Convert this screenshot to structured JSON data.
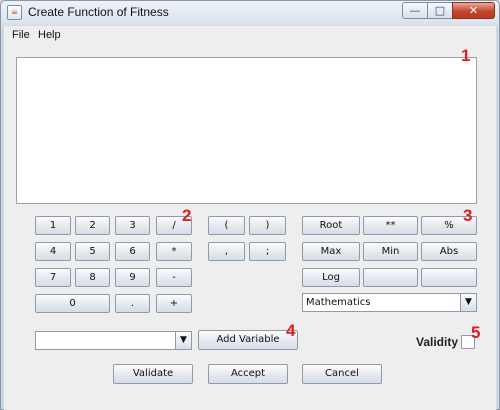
{
  "window": {
    "title": "Create Function of Fitness",
    "controls": {
      "minimize": "—",
      "maximize": "□",
      "close": "✕"
    }
  },
  "menu": [
    "File",
    "Help"
  ],
  "editor": {
    "value": ""
  },
  "keypad": {
    "row1": [
      "1",
      "2",
      "3",
      "/"
    ],
    "row2": [
      "4",
      "5",
      "6",
      "*"
    ],
    "row3": [
      "7",
      "8",
      "9",
      "-"
    ],
    "row4": [
      "0",
      ".",
      "+"
    ]
  },
  "symbols": {
    "row1": [
      "(",
      ")"
    ],
    "row2": [
      ",",
      ";"
    ]
  },
  "functions": {
    "row1": [
      "Root",
      "**",
      "%"
    ],
    "row2": [
      "Max",
      "Min",
      "Abs"
    ],
    "row3": [
      "Log",
      "",
      ""
    ]
  },
  "category_select": {
    "selected": "Mathematics"
  },
  "variable_select": {
    "selected": ""
  },
  "add_variable_label": "Add Variable",
  "validity": {
    "label": "Validity",
    "checked": false
  },
  "actions": {
    "validate": "Validate",
    "accept": "Accept",
    "cancel": "Cancel"
  },
  "markers": [
    "1",
    "2",
    "3",
    "4",
    "5"
  ],
  "colors": {
    "marker": "#d9201a",
    "close_button": "#c6452b"
  }
}
